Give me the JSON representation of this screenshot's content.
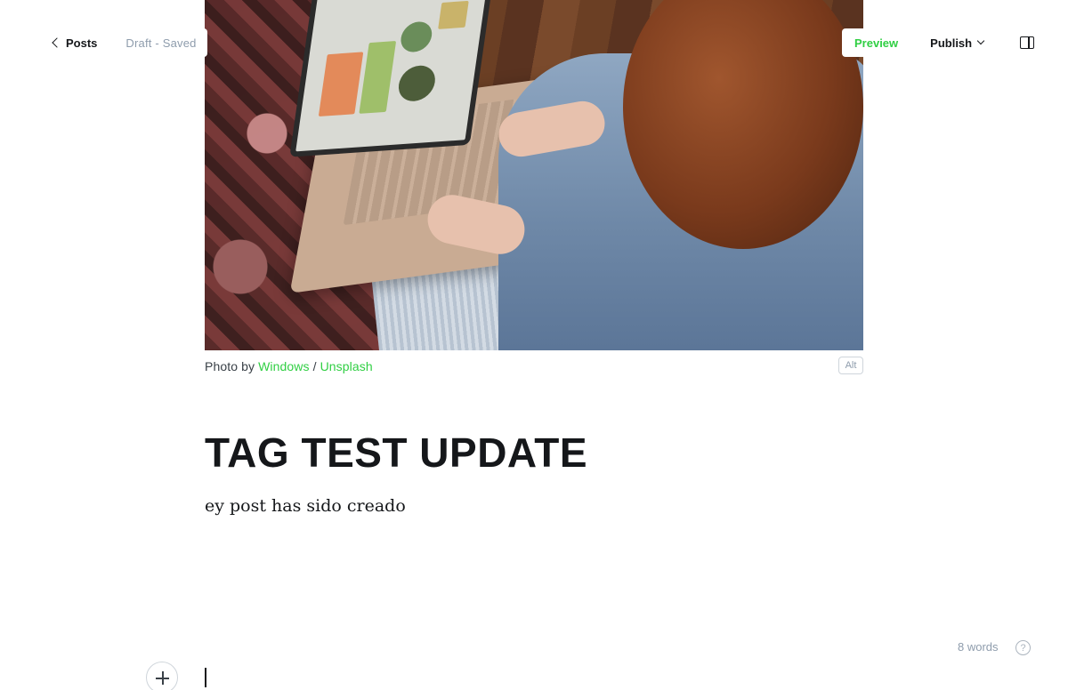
{
  "topbar": {
    "back_label": "Posts",
    "status": "Draft - Saved",
    "preview_label": "Preview",
    "publish_label": "Publish"
  },
  "feature_image": {
    "caption_prefix": "Photo by",
    "author_link": "Windows",
    "separator": "/",
    "source_link": "Unsplash",
    "alt_label": "Alt"
  },
  "post": {
    "title": "TAG TEST UPDATE",
    "body": "ey post has sido creado"
  },
  "footer": {
    "word_count": "8 words",
    "help_symbol": "?"
  },
  "icons": {
    "back": "chevron-left-icon",
    "publish": "chevron-down-icon",
    "sidebar": "sidebar-toggle-icon",
    "help": "question-circle-icon",
    "add": "plus-icon"
  },
  "colors": {
    "accent": "#30cf43",
    "muted": "#8e9cac",
    "text": "#15171a"
  }
}
